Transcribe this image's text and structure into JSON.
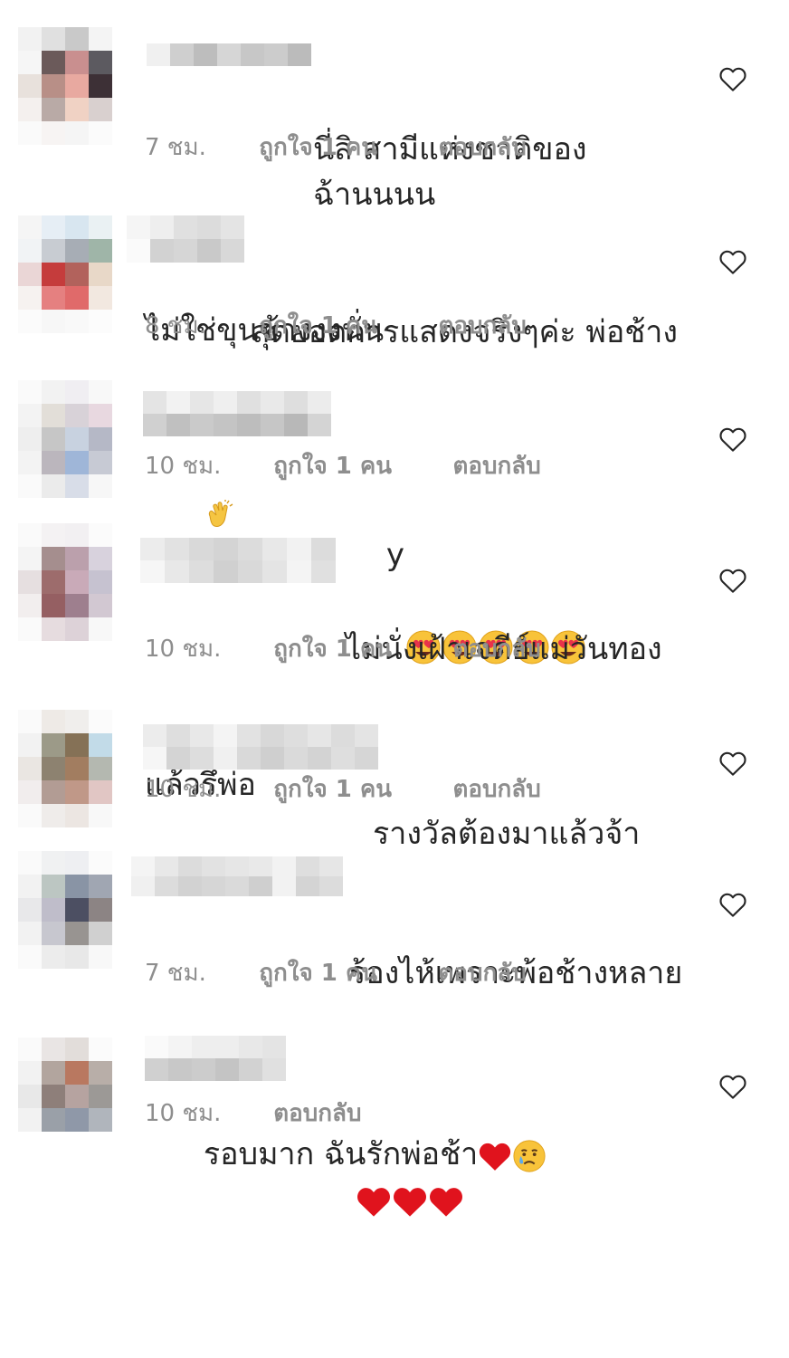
{
  "comments": [
    {
      "text_line1": "นี่สิ สามีแห่งชาติของฉ้านนนน",
      "text_line2": "ไม่ใช่ขุนช้างงงนั่น",
      "time": "7 ชม.",
      "likes": "ถูกใจ 1 คน",
      "reply": "ตอบกลับ"
    },
    {
      "text_line1": "สุดยอดการแสดงจริงๆค่ะ พ่อช้าง",
      "text_line2": "",
      "time": "8 ชม.",
      "likes": "ถูกใจ 1 คน",
      "reply": "ตอบกลับ"
    },
    {
      "text_line1": "y",
      "text_line2": "",
      "time": "10 ชม.",
      "likes": "ถูกใจ 1 คน",
      "reply": "ตอบกลับ"
    },
    {
      "text_line1": "ไม่นั่งเฝ้าเจดีย์แม่วันทอง",
      "text_line2": "แล้วรึพ่อ",
      "time": "10 ชม.",
      "likes": "ถูกใจ 1 คน",
      "reply": "ตอบกลับ"
    },
    {
      "text_line1": "รางวัลต้องมาแล้วจ้า",
      "text_line2": "",
      "time": "10 ชม.",
      "likes": "ถูกใจ 1 คน",
      "reply": "ตอบกลับ"
    },
    {
      "text_line1": "ร้องไห้เพราะพ้อช้างหลาย",
      "text_line2": "รอบมาก ฉันรักพ่อช้า",
      "time": "7 ชม.",
      "likes": "ถูกใจ 1 คน",
      "reply": "ตอบกลับ"
    },
    {
      "text_line1": "",
      "text_line2": "",
      "time": "10 ชม.",
      "likes": "",
      "reply": "ตอบกลับ"
    }
  ],
  "icons": {
    "like": "heart-outline-icon",
    "clap": "clapping-hands-emoji",
    "heart_eyes": "heart-eyes-emoji",
    "red_heart": "red-heart-emoji",
    "crying": "crying-face-emoji"
  },
  "colors": {
    "text": "#262626",
    "meta": "#8e8e8e",
    "background": "#ffffff"
  }
}
